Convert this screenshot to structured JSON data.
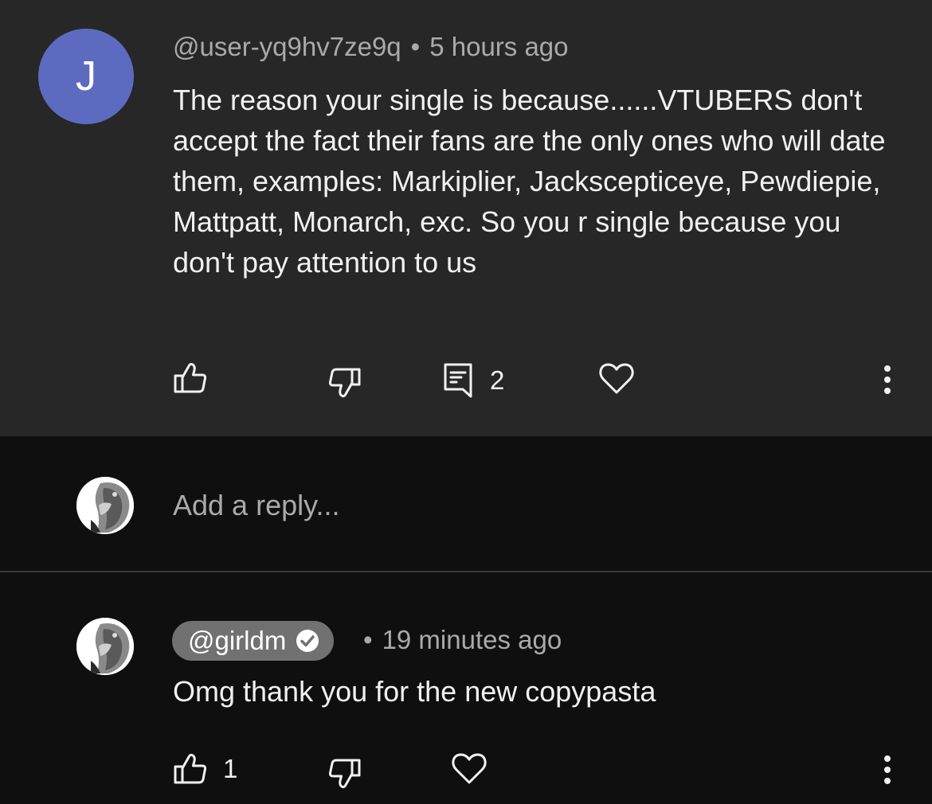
{
  "comment": {
    "avatar_letter": "J",
    "username": "@user-yq9hv7ze9q",
    "separator": "•",
    "timestamp": "5 hours ago",
    "body": "The reason your single is because......VTUBERS don't accept the fact their fans are the only ones who will date them, examples: Markiplier, Jackscepticeye, Pewdiepie, Mattpatt, Monarch, exc. So you r single because you don't pay attention to us",
    "reply_count": "2",
    "icons": [
      "thumbs-up-icon",
      "thumbs-down-icon",
      "reply-icon",
      "heart-icon",
      "more-icon"
    ]
  },
  "reply_input": {
    "placeholder": "Add a reply..."
  },
  "reply": {
    "username": "@girldm",
    "verified": true,
    "separator": "•",
    "timestamp": "19 minutes ago",
    "body": "Omg thank you for the new copypasta",
    "like_count": "1",
    "icons": [
      "thumbs-up-icon",
      "thumbs-down-icon",
      "heart-icon",
      "more-icon"
    ]
  },
  "colors": {
    "comment_bg": "#272727",
    "page_bg": "#0f0f0f",
    "avatar_bg": "#5c6bc0",
    "pill_bg": "#717171",
    "secondary_text": "#aaaaaa",
    "primary_text": "#f1f1f1"
  }
}
